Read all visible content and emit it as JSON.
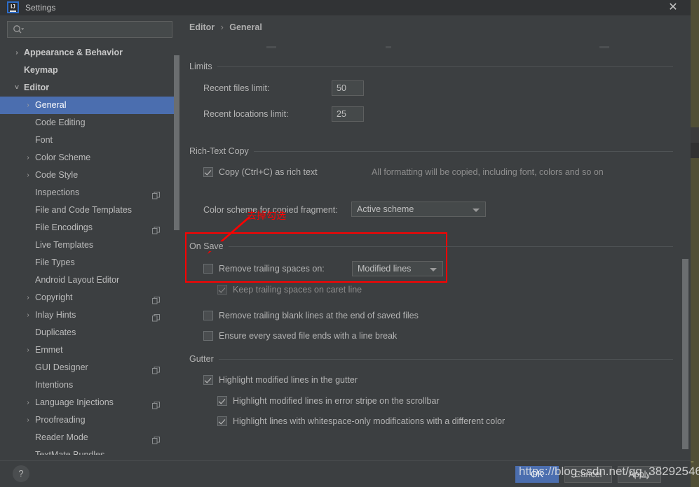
{
  "window": {
    "title": "Settings",
    "logo_text": "IJ",
    "close_label": "✕"
  },
  "search": {
    "value": "",
    "placeholder": "",
    "icon": "search-icon"
  },
  "sidebar": {
    "items": [
      {
        "label": "Appearance & Behavior",
        "level": 0,
        "arrow": "›",
        "bold": true,
        "selected": false,
        "copy_icon": false
      },
      {
        "label": "Keymap",
        "level": 0,
        "arrow": "",
        "bold": true,
        "selected": false,
        "copy_icon": false
      },
      {
        "label": "Editor",
        "level": 0,
        "arrow": "⌄",
        "bold": true,
        "selected": false,
        "copy_icon": false
      },
      {
        "label": "General",
        "level": 1,
        "arrow": "›",
        "bold": false,
        "selected": true,
        "copy_icon": false
      },
      {
        "label": "Code Editing",
        "level": 1,
        "arrow": "",
        "bold": false,
        "selected": false,
        "copy_icon": false
      },
      {
        "label": "Font",
        "level": 1,
        "arrow": "",
        "bold": false,
        "selected": false,
        "copy_icon": false
      },
      {
        "label": "Color Scheme",
        "level": 1,
        "arrow": "›",
        "bold": false,
        "selected": false,
        "copy_icon": false
      },
      {
        "label": "Code Style",
        "level": 1,
        "arrow": "›",
        "bold": false,
        "selected": false,
        "copy_icon": false
      },
      {
        "label": "Inspections",
        "level": 1,
        "arrow": "",
        "bold": false,
        "selected": false,
        "copy_icon": true
      },
      {
        "label": "File and Code Templates",
        "level": 1,
        "arrow": "",
        "bold": false,
        "selected": false,
        "copy_icon": false
      },
      {
        "label": "File Encodings",
        "level": 1,
        "arrow": "",
        "bold": false,
        "selected": false,
        "copy_icon": true
      },
      {
        "label": "Live Templates",
        "level": 1,
        "arrow": "",
        "bold": false,
        "selected": false,
        "copy_icon": false
      },
      {
        "label": "File Types",
        "level": 1,
        "arrow": "",
        "bold": false,
        "selected": false,
        "copy_icon": false
      },
      {
        "label": "Android Layout Editor",
        "level": 1,
        "arrow": "",
        "bold": false,
        "selected": false,
        "copy_icon": false
      },
      {
        "label": "Copyright",
        "level": 1,
        "arrow": "›",
        "bold": false,
        "selected": false,
        "copy_icon": true
      },
      {
        "label": "Inlay Hints",
        "level": 1,
        "arrow": "›",
        "bold": false,
        "selected": false,
        "copy_icon": true
      },
      {
        "label": "Duplicates",
        "level": 1,
        "arrow": "",
        "bold": false,
        "selected": false,
        "copy_icon": false
      },
      {
        "label": "Emmet",
        "level": 1,
        "arrow": "›",
        "bold": false,
        "selected": false,
        "copy_icon": false
      },
      {
        "label": "GUI Designer",
        "level": 1,
        "arrow": "",
        "bold": false,
        "selected": false,
        "copy_icon": true
      },
      {
        "label": "Intentions",
        "level": 1,
        "arrow": "",
        "bold": false,
        "selected": false,
        "copy_icon": false
      },
      {
        "label": "Language Injections",
        "level": 1,
        "arrow": "›",
        "bold": false,
        "selected": false,
        "copy_icon": true
      },
      {
        "label": "Proofreading",
        "level": 1,
        "arrow": "›",
        "bold": false,
        "selected": false,
        "copy_icon": false
      },
      {
        "label": "Reader Mode",
        "level": 1,
        "arrow": "",
        "bold": false,
        "selected": false,
        "copy_icon": true
      },
      {
        "label": "TextMate Bundles",
        "level": 1,
        "arrow": "",
        "bold": false,
        "selected": false,
        "copy_icon": false
      }
    ]
  },
  "breadcrumb": {
    "root": "Editor",
    "separator": "›",
    "current": "General"
  },
  "main": {
    "limits": {
      "group_title": "Limits",
      "recent_files_label": "Recent files limit:",
      "recent_files_value": "50",
      "recent_locations_label": "Recent locations limit:",
      "recent_locations_value": "25"
    },
    "rich_text_copy": {
      "group_title": "Rich-Text Copy",
      "copy_as_rich_text_label": "Copy (Ctrl+C) as rich text",
      "copy_as_rich_text_checked": true,
      "copy_hint": "All formatting will be copied, including font, colors and so on",
      "color_scheme_label": "Color scheme for copied fragment:",
      "color_scheme_value": "Active scheme"
    },
    "on_save": {
      "group_title": "On Save",
      "remove_trailing_spaces_label": "Remove trailing spaces on:",
      "remove_trailing_spaces_checked": false,
      "remove_trailing_spaces_value": "Modified lines",
      "keep_trailing_spaces_label": "Keep trailing spaces on caret line",
      "keep_trailing_spaces_checked": true,
      "remove_blank_lines_label": "Remove trailing blank lines at the end of saved files",
      "remove_blank_lines_checked": false,
      "ensure_line_break_label": "Ensure every saved file ends with a line break",
      "ensure_line_break_checked": false
    },
    "gutter": {
      "group_title": "Gutter",
      "highlight_modified_label": "Highlight modified lines in the gutter",
      "highlight_modified_checked": true,
      "highlight_error_stripe_label": "Highlight modified lines in error stripe on the scrollbar",
      "highlight_error_stripe_checked": true,
      "highlight_whitespace_label": "Highlight lines with whitespace-only modifications with a different color",
      "highlight_whitespace_checked": true
    }
  },
  "annotation": {
    "text": "去掉勾选",
    "color": "#ff0000"
  },
  "footer": {
    "help_label": "?",
    "ok_label": "OK",
    "cancel_label": "Cancel",
    "apply_label": "Apply"
  },
  "watermark": {
    "text": "https://blog.csdn.net/qq_38292546"
  },
  "colors": {
    "dialog_bg": "#3c3f41",
    "titlebar_bg": "#313335",
    "selection_blue": "#4b6eaf",
    "text": "#bbbbbb",
    "dim_text": "#8d8d8d",
    "field_bg": "#45494a",
    "annotation_red": "#ff0000",
    "backdrop_olive": "#4e4e33"
  }
}
